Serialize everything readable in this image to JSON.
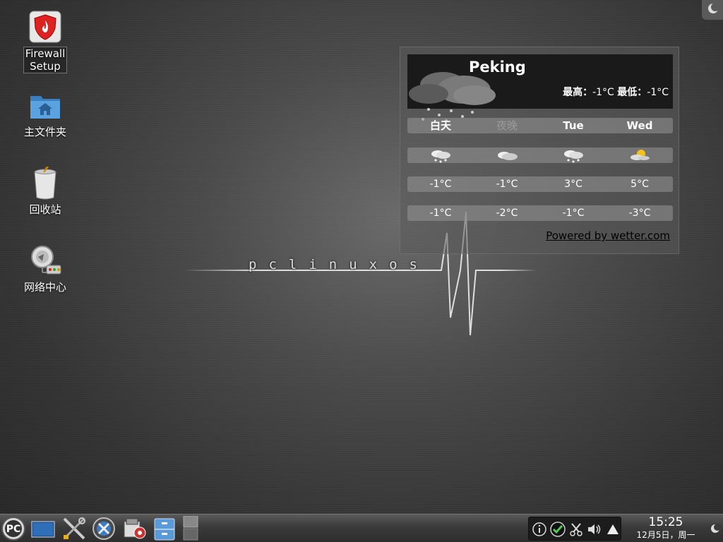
{
  "desktop_icons": [
    {
      "label_line1": "Firewall",
      "label_line2": "Setup"
    },
    {
      "label": "主文件夹"
    },
    {
      "label": "回收站"
    },
    {
      "label": "网络中心"
    }
  ],
  "weather": {
    "city": "Peking",
    "high_label": "最高：",
    "high_value": "-1°C",
    "low_label": "最低：",
    "low_value": "-1°C",
    "days": [
      "白天",
      "夜晚",
      "Tue",
      "Wed"
    ],
    "conditions": [
      "snow-cloud-icon",
      "cloud-icon",
      "snow-cloud-icon",
      "sun-cloud-icon"
    ],
    "highs": [
      "-1°C",
      "-1°C",
      "3°C",
      "5°C"
    ],
    "lows": [
      "-1°C",
      "-2°C",
      "-1°C",
      "-3°C"
    ],
    "powered_by": "Powered by wetter.com"
  },
  "logo": {
    "text": "pclinuxos"
  },
  "taskbar": {
    "launcher": "PC",
    "clock_time": "15:25",
    "clock_date": "12月5日，周一"
  }
}
